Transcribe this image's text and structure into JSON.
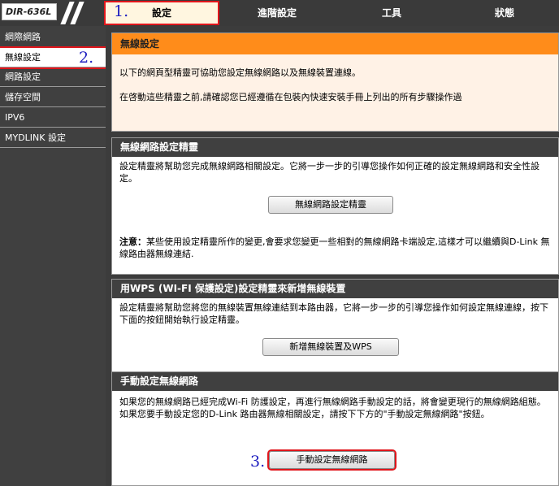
{
  "header": {
    "model": "DIR-636L",
    "tabs": [
      {
        "label": "設定",
        "active": true
      },
      {
        "label": "進階設定",
        "active": false
      },
      {
        "label": "工具",
        "active": false
      },
      {
        "label": "狀態",
        "active": false
      }
    ]
  },
  "sidebar": {
    "items": [
      {
        "label": "網際網路",
        "active": false
      },
      {
        "label": "無線設定",
        "active": true
      },
      {
        "label": "網路設定",
        "active": false
      },
      {
        "label": "儲存空間",
        "active": false
      },
      {
        "label": "IPV6",
        "active": false
      },
      {
        "label": "MYDLINK 設定",
        "active": false
      }
    ]
  },
  "steps": {
    "step1": "1.",
    "step2": "2.",
    "step3": "3."
  },
  "intro": {
    "title": "無線設定",
    "line1": "以下的網頁型精靈可協助您設定無線網路以及無線裝置連線。",
    "line2": "在啓動這些精靈之前,請確認您已經遵循在包裝內快速安裝手冊上列出的所有步驟操作過"
  },
  "wizard": {
    "title": "無線網路設定精靈",
    "description": "設定精靈將幫助您完成無線網路相關設定。它將一步一步的引導您操作如何正確的設定無線網路和安全性設定。",
    "button": "無線網路設定精靈",
    "note_label": "注意：",
    "note_text": "某些使用設定精靈所作的變更,會要求您變更一些相對的無線網路卡端設定,這樣才可以繼續與D-Link 無線路由器無線連結."
  },
  "wps": {
    "title": "用WPS (WI-FI 保護設定)設定精靈來新增無線裝置",
    "description": "設定精靈將幫助您將您的無線裝置無線連結到本路由器，它將一步一步的引導您操作如何設定無線連線，按下下面的按鈕開始執行設定精靈。",
    "button": "新增無線裝置及WPS"
  },
  "manual": {
    "title": "手動設定無線網路",
    "description": "如果您的無線網路已經完成Wi-Fi 防護設定，再進行無線網路手動設定的話，將會變更現行的無線網路組態。 如果您要手動設定您的D-Link 路由器無線相關設定，請按下下方的\"手動設定無線網路\"按鈕。",
    "button": "手動設定無線網路"
  },
  "colors": {
    "highlight": "#e0151b",
    "accent_orange": "#ff8c1a",
    "dark": "#404040",
    "step_blue": "#2020c0"
  }
}
